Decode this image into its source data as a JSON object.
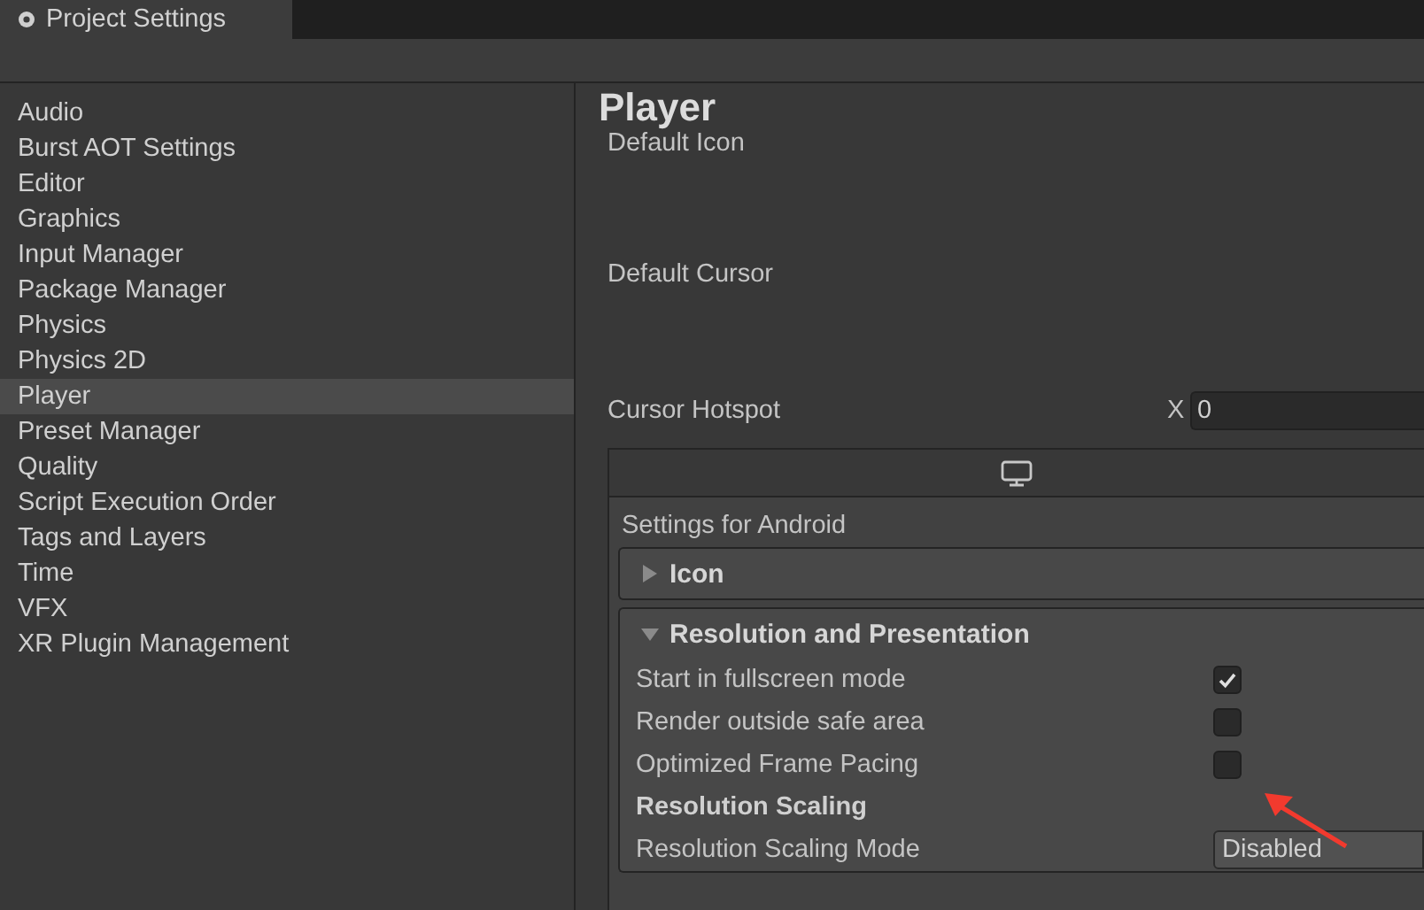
{
  "window": {
    "title": "Project Settings"
  },
  "sidebar": {
    "items": [
      {
        "label": "Audio",
        "selected": false
      },
      {
        "label": "Burst AOT Settings",
        "selected": false
      },
      {
        "label": "Editor",
        "selected": false
      },
      {
        "label": "Graphics",
        "selected": false
      },
      {
        "label": "Input Manager",
        "selected": false
      },
      {
        "label": "Package Manager",
        "selected": false
      },
      {
        "label": "Physics",
        "selected": false
      },
      {
        "label": "Physics 2D",
        "selected": false
      },
      {
        "label": "Player",
        "selected": true
      },
      {
        "label": "Preset Manager",
        "selected": false
      },
      {
        "label": "Quality",
        "selected": false
      },
      {
        "label": "Script Execution Order",
        "selected": false
      },
      {
        "label": "Tags and Layers",
        "selected": false
      },
      {
        "label": "Time",
        "selected": false
      },
      {
        "label": "VFX",
        "selected": false
      },
      {
        "label": "XR Plugin Management",
        "selected": false
      }
    ]
  },
  "content": {
    "title": "Player",
    "default_icon": "Default Icon",
    "default_cursor": "Default Cursor",
    "cursor_hotspot": {
      "label": "Cursor Hotspot",
      "x_label": "X",
      "x_value": "0"
    },
    "platform_box": {
      "settings_label": "Settings for Android",
      "sections": [
        {
          "title": "Icon",
          "expanded": false
        },
        {
          "title": "Resolution and Presentation",
          "expanded": true
        }
      ],
      "rows": [
        {
          "kind": "checkbox",
          "label": "Start in fullscreen mode",
          "checked": true
        },
        {
          "kind": "checkbox",
          "label": "Render outside safe area",
          "checked": false
        },
        {
          "kind": "checkbox",
          "label": "Optimized Frame Pacing",
          "checked": false
        },
        {
          "kind": "heading",
          "label": "Resolution Scaling"
        },
        {
          "kind": "dropdown",
          "label": "Resolution Scaling Mode",
          "value": "Disabled"
        }
      ]
    }
  }
}
